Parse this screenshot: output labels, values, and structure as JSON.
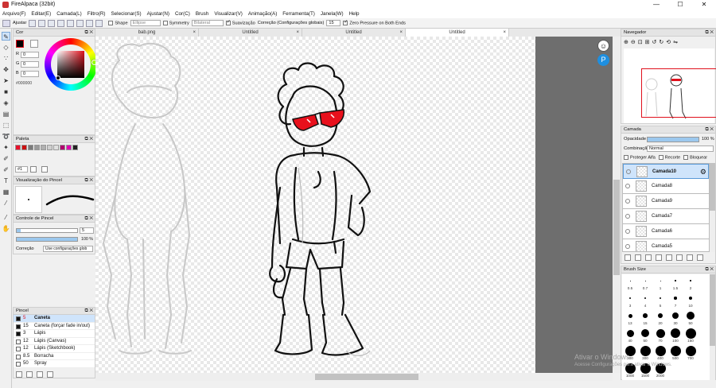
{
  "window": {
    "title": "FireAlpaca (32bit)",
    "min": "—",
    "max": "☐",
    "close": "✕"
  },
  "menu": [
    "Arquivo(F)",
    "Editar(E)",
    "Camada(L)",
    "Filtro(R)",
    "Selecionar(S)",
    "Ajustar(N)",
    "Cor(C)",
    "Brush",
    "Visualizar(V)",
    "Animação(A)",
    "Ferramenta(T)",
    "Janela(W)",
    "Help"
  ],
  "toolbar": {
    "fit_label": "Ajustar",
    "shape_label": "Shape",
    "shape_value": "Ellipse",
    "symmetry_label": "Symmetry",
    "symmetry_value": "Bilateral",
    "smoothing_label": "Suavização",
    "correction_label": "Correção (Configurações globais)",
    "correction_value": "15",
    "zero_pressure_label": "Zero Pressure on Both Ends"
  },
  "tabs": [
    {
      "label": "bab.png",
      "active": false
    },
    {
      "label": "Untitled",
      "active": false
    },
    {
      "label": "Untitled",
      "active": false
    },
    {
      "label": "Untitled",
      "active": true
    }
  ],
  "tab_close": "×",
  "color_panel": {
    "title": "Cor",
    "r_label": "R",
    "r": "0",
    "g_label": "G",
    "g": "0",
    "b_label": "B",
    "b": "0",
    "hex": "#000000",
    "primary": "#000000",
    "secondary": "#ffffff",
    "accent": "#e0101c"
  },
  "palette_panel": {
    "title": "Paleta",
    "swatches": [
      "#e8102a",
      "#cc1010",
      "#7a7a7a",
      "#9a9a9a",
      "#b0b0b0",
      "#cfcfcf",
      "#e0e0e0",
      "#b0006e",
      "#e000b0",
      "#222222"
    ],
    "select_value": "#1"
  },
  "brush_preview": {
    "title": "Visualização do Pincel"
  },
  "brush_control": {
    "title": "Controle de Pincel",
    "size": "5",
    "opacity": "100 %",
    "correction_label": "Correção",
    "correction_value": "Use configurações glob"
  },
  "brush_panel": {
    "title": "Pincel",
    "items": [
      {
        "size": "5",
        "name": "Caneta"
      },
      {
        "size": "15",
        "name": "Caneta (forçar fade in/out)"
      },
      {
        "size": "3",
        "name": "Lápis"
      },
      {
        "size": "12",
        "name": "Lápis (Canvas)"
      },
      {
        "size": "12",
        "name": "Lápis (Sketchbook)"
      },
      {
        "size": "8.5",
        "name": "Borracha"
      },
      {
        "size": "50",
        "name": "Spray"
      }
    ]
  },
  "navigator": {
    "title": "Navegador"
  },
  "layer_panel": {
    "title": "Camada",
    "opacity_label": "Opacidade",
    "opacity_value": "100 %",
    "opacity": 1.0,
    "blend_label": "Combinação",
    "blend_value": "Normal",
    "protect_alpha": "Proteger Alfa",
    "clipping": "Recorte",
    "lock": "Bloquear",
    "layers": [
      "Camada10",
      "Camada8",
      "Camada9",
      "Camada7",
      "Camada6",
      "Camada5"
    ]
  },
  "brush_size_panel": {
    "title": "Brush Size",
    "labels": [
      "0.5",
      "0.7",
      "1",
      "1.5",
      "2",
      "3",
      "4",
      "5",
      "7",
      "10",
      "13",
      "15",
      "20",
      "30",
      "50",
      "40",
      "50",
      "70",
      "100",
      "150",
      "200",
      "300",
      "400",
      "500",
      "700",
      "1000",
      "1500",
      "2000"
    ]
  },
  "watermark": {
    "line1": "Ativar o Windows",
    "line2": "Acesse Configurações para ativar o Windows."
  }
}
